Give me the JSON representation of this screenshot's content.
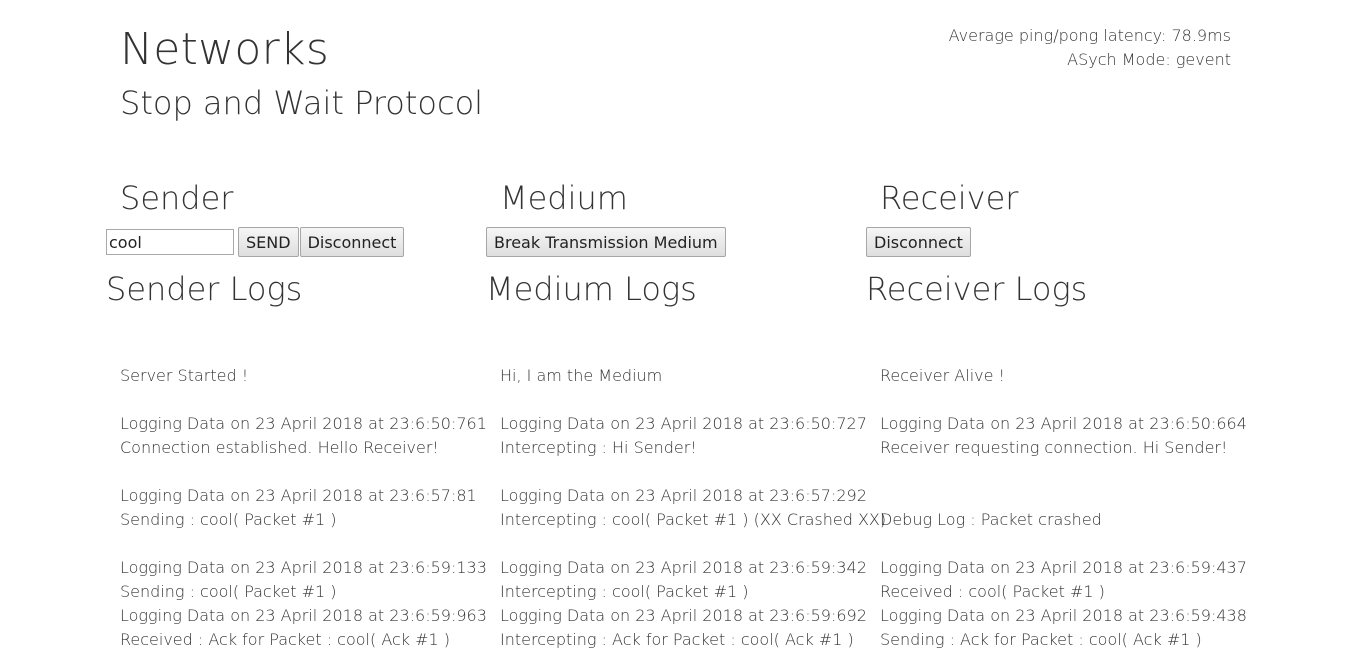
{
  "header": {
    "title": "Networks",
    "subtitle": "Stop and Wait Protocol",
    "latency": "Average ping/pong latency: 78.9ms",
    "async_mode": "ASych Mode: gevent"
  },
  "sender": {
    "heading": "Sender",
    "input_value": "cool",
    "send_label": "SEND",
    "disconnect_label": "Disconnect",
    "logs_heading": "Sender Logs",
    "logs": [
      [
        "Server Started !"
      ],
      [
        "Logging Data on 23 April 2018 at 23:6:50:761",
        "Connection established. Hello Receiver!"
      ],
      [
        "Logging Data on 23 April 2018 at 23:6:57:81",
        "Sending : cool( Packet #1 )"
      ],
      [
        "Logging Data on 23 April 2018 at 23:6:59:133",
        "Sending : cool( Packet #1 )",
        "Logging Data on 23 April 2018 at 23:6:59:963",
        "Received : Ack for Packet : cool( Ack #1 )"
      ]
    ]
  },
  "medium": {
    "heading": "Medium",
    "break_label": "Break Transmission Medium",
    "logs_heading": "Medium Logs",
    "logs": [
      [
        "Hi, I am the Medium"
      ],
      [
        "Logging Data on 23 April 2018 at 23:6:50:727",
        "Intercepting : Hi Sender!"
      ],
      [
        "Logging Data on 23 April 2018 at 23:6:57:292",
        "Intercepting : cool( Packet #1 ) (XX Crashed XX)"
      ],
      [
        "Logging Data on 23 April 2018 at 23:6:59:342",
        "Intercepting : cool( Packet #1 )",
        "Logging Data on 23 April 2018 at 23:6:59:692",
        "Intercepting : Ack for Packet : cool( Ack #1 )"
      ]
    ]
  },
  "receiver": {
    "heading": "Receiver",
    "disconnect_label": "Disconnect",
    "logs_heading": "Receiver Logs",
    "logs": [
      [
        "Receiver Alive !"
      ],
      [
        "Logging Data on 23 April 2018 at 23:6:50:664",
        "Receiver requesting connection. Hi Sender!"
      ],
      [
        "",
        "Debug Log : Packet crashed"
      ],
      [
        "Logging Data on 23 April 2018 at 23:6:59:437",
        "Received : cool( Packet #1 )",
        "Logging Data on 23 April 2018 at 23:6:59:438",
        "Sending : Ack for Packet : cool( Ack #1 )"
      ]
    ]
  }
}
